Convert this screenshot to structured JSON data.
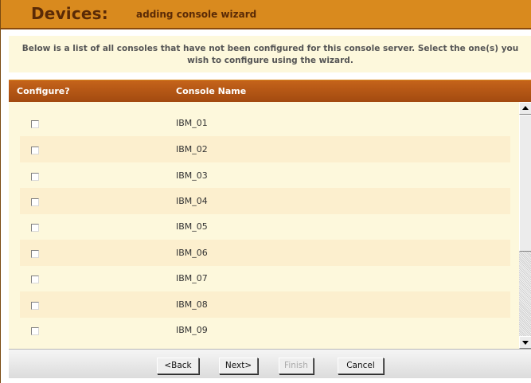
{
  "header": {
    "title": "Devices:",
    "subtitle": "adding console wizard"
  },
  "instructions": {
    "line1": "Below is a list of all consoles that have not been configured for this console server. Select the one(s) you",
    "line2": "wish to configure using the wizard."
  },
  "table": {
    "columns": [
      "Configure?",
      "Console Name"
    ],
    "rows": [
      {
        "name": "IBM_01",
        "checked": false
      },
      {
        "name": "IBM_02",
        "checked": false
      },
      {
        "name": "IBM_03",
        "checked": false
      },
      {
        "name": "IBM_04",
        "checked": false
      },
      {
        "name": "IBM_05",
        "checked": false
      },
      {
        "name": "IBM_06",
        "checked": false
      },
      {
        "name": "IBM_07",
        "checked": false
      },
      {
        "name": "IBM_08",
        "checked": false
      },
      {
        "name": "IBM_09",
        "checked": false
      }
    ]
  },
  "footer": {
    "back_label": "<Back",
    "next_label": "Next>",
    "finish_label": "Finish",
    "cancel_label": "Cancel",
    "finish_disabled": true
  },
  "colors": {
    "title_bar": "#d98a1e",
    "title_text": "#5a2a06",
    "header_row": "#b4561a",
    "panel_bg": "#fdf8dc",
    "row_alt_bg": "#fcefce"
  }
}
